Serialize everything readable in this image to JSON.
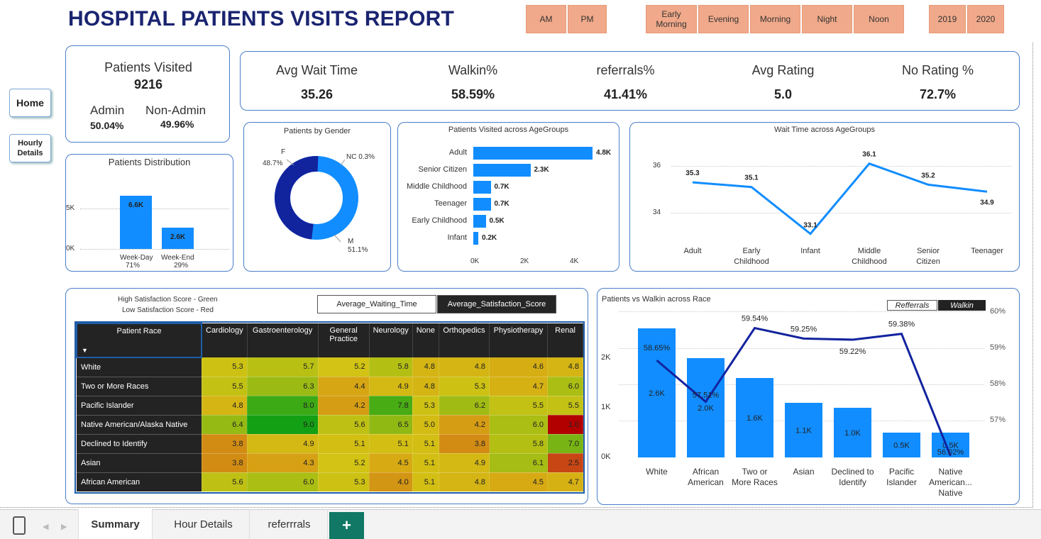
{
  "title": "HOSPITAL PATIENTS VISITS REPORT",
  "slicers": {
    "ampm": [
      "AM",
      "PM"
    ],
    "daypart": [
      "Early Morning",
      "Evening",
      "Morning",
      "Night",
      "Noon"
    ],
    "year": [
      "2019",
      "2020"
    ]
  },
  "nav": {
    "home": "Home",
    "hourly": "Hourly Details"
  },
  "kpi_left": {
    "patients_label": "Patients Visited",
    "patients_value": "9216",
    "admin_label": "Admin",
    "admin_value": "50.04%",
    "nonadmin_label": "Non-Admin",
    "nonadmin_value": "49.96%"
  },
  "kpis": [
    {
      "label": "Avg Wait Time",
      "value": "35.26"
    },
    {
      "label": "Walkin%",
      "value": "58.59%"
    },
    {
      "label": "referrals%",
      "value": "41.41%"
    },
    {
      "label": "Avg Rating",
      "value": "5.0"
    },
    {
      "label": "No Rating %",
      "value": "72.7%"
    }
  ],
  "distribution": {
    "title": "Patients Distribution",
    "ticks": [
      "5K",
      "0K"
    ],
    "bars": [
      {
        "cat": "Week-Day",
        "pct": "71%",
        "label": "6.6K",
        "value": 6600
      },
      {
        "cat": "Week-End",
        "pct": "29%",
        "label": "2.6K",
        "value": 2600
      }
    ]
  },
  "gender": {
    "title": "Patients by Gender",
    "f_label": "F",
    "f_pct": "48.7%",
    "nc_label": "NC 0.3%",
    "m_label": "M",
    "m_pct": "51.1%",
    "colors": {
      "F": "#12239e",
      "M": "#118dff"
    }
  },
  "agegroups": {
    "title": "Patients Visited across AgeGroups",
    "rows": [
      {
        "cat": "Adult",
        "label": "4.8K",
        "value": 4800
      },
      {
        "cat": "Senior Citizen",
        "label": "2.3K",
        "value": 2300
      },
      {
        "cat": "Middle Childhood",
        "label": "0.7K",
        "value": 700
      },
      {
        "cat": "Teenager",
        "label": "0.7K",
        "value": 700
      },
      {
        "cat": "Early Childhood",
        "label": "0.5K",
        "value": 500
      },
      {
        "cat": "Infant",
        "label": "0.2K",
        "value": 200
      }
    ],
    "ticks": [
      "0K",
      "2K",
      "4K"
    ]
  },
  "waittime": {
    "title": "Wait Time across AgeGroups",
    "yticks": [
      "36",
      "34"
    ],
    "points": [
      {
        "cat": "Adult",
        "value": 35.3,
        "label": "35.3"
      },
      {
        "cat": "Early Childhood",
        "value": 35.1,
        "label": "35.1"
      },
      {
        "cat": "Infant",
        "value": 33.1,
        "label": "33.1"
      },
      {
        "cat": "Middle Childhood",
        "value": 36.1,
        "label": "36.1"
      },
      {
        "cat": "Senior Citizen",
        "value": 35.2,
        "label": "35.2"
      },
      {
        "cat": "Teenager",
        "value": 34.9,
        "label": "34.9"
      }
    ]
  },
  "matrix": {
    "legend1": "High Satisfaction Score - Green",
    "legend2": "Low Satisfaction Score - Red",
    "btn_wait": "Average_Waiting_Time",
    "btn_sat": "Average_Satisfaction_Score",
    "corner": "Patient Race",
    "cols": [
      "Cardiology",
      "Gastroenterology",
      "General Practice",
      "Neurology",
      "None",
      "Orthopedics",
      "Physiotherapy",
      "Renal"
    ],
    "rows": [
      {
        "race": "White",
        "vals": [
          "5.3",
          "5.7",
          "5.2",
          "5.8",
          "4.8",
          "4.8",
          "4.6",
          "4.8"
        ]
      },
      {
        "race": "Two or More Races",
        "vals": [
          "5.5",
          "6.3",
          "4.4",
          "4.9",
          "4.8",
          "5.3",
          "4.7",
          "6.0"
        ]
      },
      {
        "race": "Pacific Islander",
        "vals": [
          "4.8",
          "8.0",
          "4.2",
          "7.8",
          "5.3",
          "6.2",
          "5.5",
          "5.5"
        ]
      },
      {
        "race": "Native American/Alaska Native",
        "vals": [
          "6.4",
          "9.0",
          "5.6",
          "6.5",
          "5.0",
          "4.2",
          "6.0",
          "1.0"
        ]
      },
      {
        "race": "Declined to Identify",
        "vals": [
          "3.8",
          "4.9",
          "5.1",
          "5.1",
          "5.1",
          "3.8",
          "5.8",
          "7.0"
        ]
      },
      {
        "race": "Asian",
        "vals": [
          "3.8",
          "4.3",
          "5.2",
          "4.5",
          "5.1",
          "4.9",
          "6.1",
          "2.5"
        ]
      },
      {
        "race": "African American",
        "vals": [
          "5.6",
          "6.0",
          "5.3",
          "4.0",
          "5.1",
          "4.8",
          "4.5",
          "4.7"
        ]
      }
    ]
  },
  "race_chart": {
    "title": "Patients vs Walkin across Race",
    "legend_ref": "Refferrals",
    "legend_walk": "Walkin",
    "yleft": [
      "2K",
      "1K",
      "0K"
    ],
    "yright": [
      "60%",
      "59%",
      "58%",
      "57%"
    ],
    "bars": [
      {
        "cat": "White",
        "value": 2600,
        "label": "2.6K",
        "pct": 58.65,
        "pct_label": "58.65%"
      },
      {
        "cat": "African American",
        "value": 2000,
        "label": "2.0K",
        "pct": 57.51,
        "pct_label": "57.51%"
      },
      {
        "cat": "Two or More Races",
        "value": 1600,
        "label": "1.6K",
        "pct": 59.54,
        "pct_label": "59.54%"
      },
      {
        "cat": "Asian",
        "value": 1100,
        "label": "1.1K",
        "pct": 59.25,
        "pct_label": "59.25%"
      },
      {
        "cat": "Declined to Identify",
        "value": 1000,
        "label": "1.0K",
        "pct": 59.22,
        "pct_label": "59.22%"
      },
      {
        "cat": "Pacific Islander",
        "value": 500,
        "label": "0.5K",
        "pct": 59.38,
        "pct_label": "59.38%"
      },
      {
        "cat": "Native American... Native",
        "value": 500,
        "label": "0.5K",
        "pct": 56.02,
        "pct_label": "56.02%"
      }
    ]
  },
  "tabs": [
    "Summary",
    "Hour Details",
    "referrrals"
  ],
  "add_tab": "+"
}
